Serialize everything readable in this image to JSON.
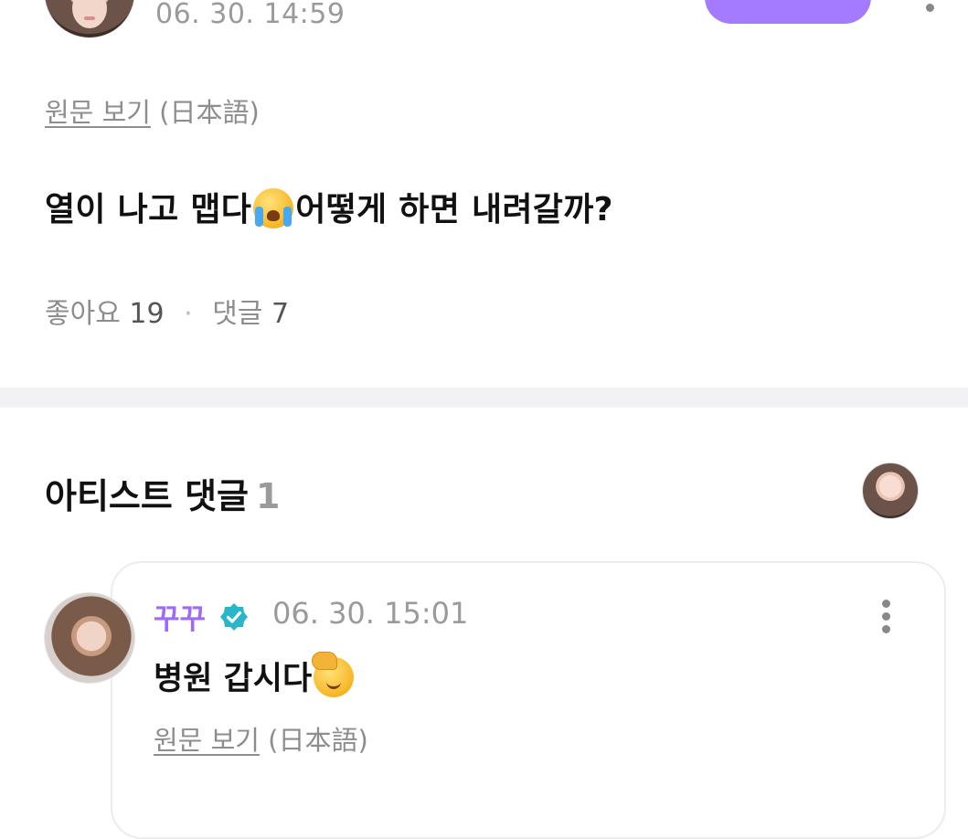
{
  "post": {
    "timestamp": "06. 30. 14:59",
    "original_link": "원문 보기",
    "original_lang": "(日本語)",
    "body_before_emoji": "열이 나고 맵다",
    "body_emoji": "loudly-crying-face-emoji",
    "body_after_emoji": "어떻게 하면 내려갈까?",
    "likes_label": "좋아요",
    "likes_count": "19",
    "separator": "·",
    "comments_label": "댓글",
    "comments_count": "7"
  },
  "artist_comments": {
    "title": "아티스트 댓글",
    "count": "1",
    "items": [
      {
        "name": "꾸꾸",
        "verified_icon": "verified-badge-icon",
        "timestamp": "06. 30. 15:01",
        "text": "병원 갑시다",
        "emoji": "saluting-face-emoji",
        "original_link": "원문 보기",
        "original_lang": "(日本語)"
      }
    ]
  },
  "colors": {
    "accent_purple": "#a47bff",
    "artist_name": "#9c6cf6",
    "verified_teal": "#2bb5c9",
    "muted_text": "#8d8d8d",
    "divider": "#f2f2f4"
  }
}
